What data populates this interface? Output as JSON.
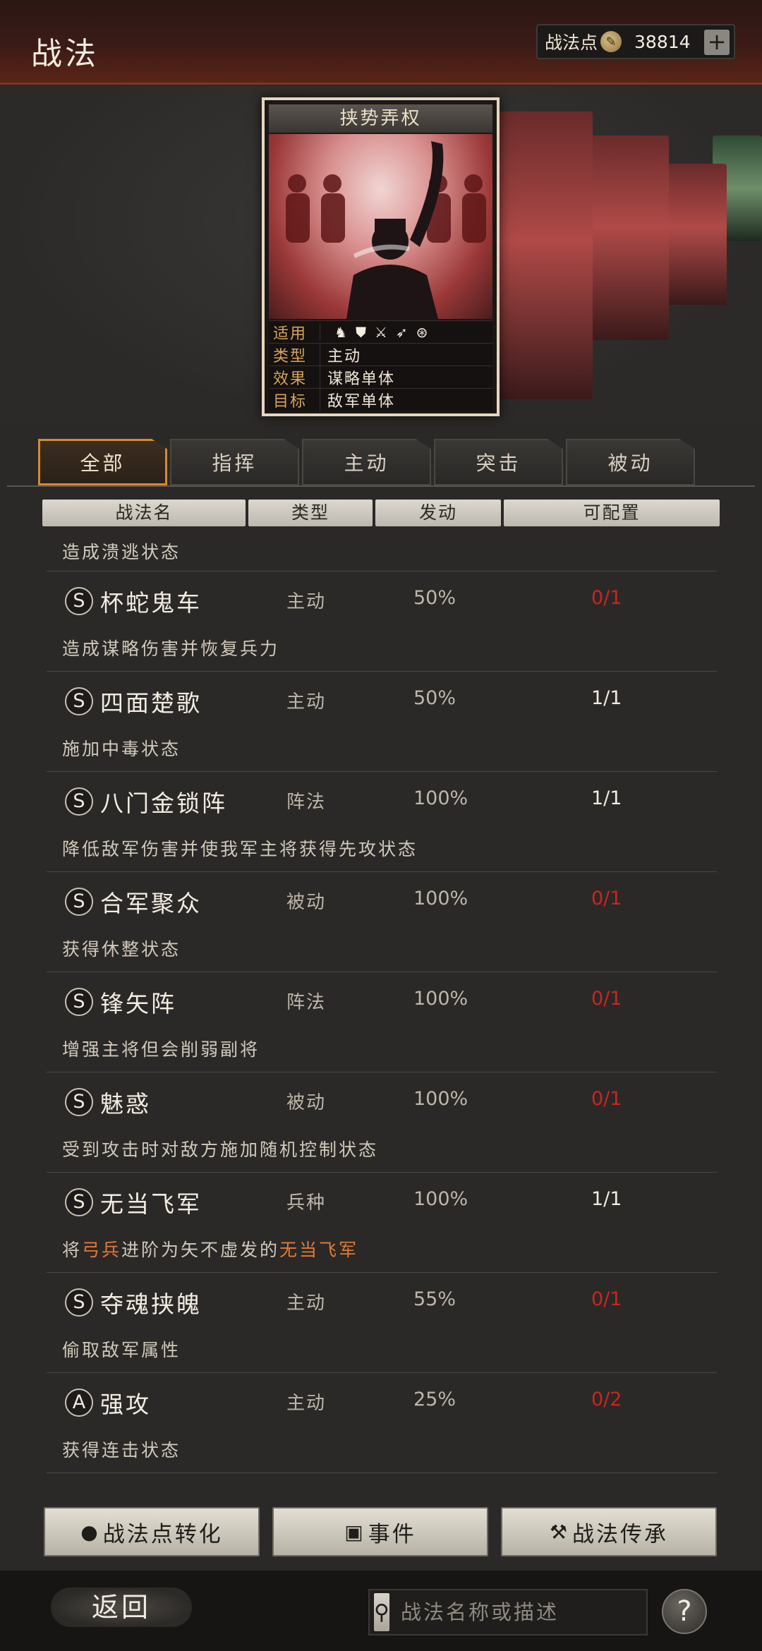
{
  "header": {
    "title": "战法",
    "points_label": "战法点",
    "points_value": "38814",
    "plus_label": "+"
  },
  "card": {
    "name": "挟势弄权",
    "rows": [
      {
        "key": "适用",
        "value": ""
      },
      {
        "key": "类型",
        "value": "主动"
      },
      {
        "key": "效果",
        "value": "谋略单体"
      },
      {
        "key": "目标",
        "value": "敌军单体"
      }
    ],
    "unit_icons": [
      "♞",
      "⛊",
      "⚔",
      "➶",
      "⊛"
    ]
  },
  "tabs": [
    "全部",
    "指挥",
    "主动",
    "突击",
    "被动"
  ],
  "columns": [
    "战法名",
    "类型",
    "发动",
    "可配置"
  ],
  "list": {
    "top_desc": "造成溃逃状态",
    "rows": [
      {
        "grade": "S",
        "name": "杯蛇鬼车",
        "type": "主动",
        "rate": "50%",
        "config": "0/1",
        "config_red": true,
        "desc": "造成谋略伤害并恢复兵力"
      },
      {
        "grade": "S",
        "name": "四面楚歌",
        "type": "主动",
        "rate": "50%",
        "config": "1/1",
        "config_red": false,
        "desc": "施加中毒状态"
      },
      {
        "grade": "S",
        "name": "八门金锁阵",
        "type": "阵法",
        "rate": "100%",
        "config": "1/1",
        "config_red": false,
        "desc": "降低敌军伤害并使我军主将获得先攻状态"
      },
      {
        "grade": "S",
        "name": "合军聚众",
        "type": "被动",
        "rate": "100%",
        "config": "0/1",
        "config_red": true,
        "desc": "获得休整状态"
      },
      {
        "grade": "S",
        "name": "锋矢阵",
        "type": "阵法",
        "rate": "100%",
        "config": "0/1",
        "config_red": true,
        "desc": "增强主将但会削弱副将"
      },
      {
        "grade": "S",
        "name": "魅惑",
        "type": "被动",
        "rate": "100%",
        "config": "0/1",
        "config_red": true,
        "desc": "受到攻击时对敌方施加随机控制状态"
      },
      {
        "grade": "S",
        "name": "无当飞军",
        "type": "兵种",
        "rate": "100%",
        "config": "1/1",
        "config_red": false,
        "desc_parts": [
          "将",
          "弓兵",
          "进阶为矢不虚发的",
          "无当飞军"
        ]
      },
      {
        "grade": "S",
        "name": "夺魂挟魄",
        "type": "主动",
        "rate": "55%",
        "config": "0/1",
        "config_red": true,
        "desc": "偷取敌军属性"
      },
      {
        "grade": "A",
        "name": "强攻",
        "type": "主动",
        "rate": "25%",
        "config": "0/2",
        "config_red": true,
        "desc": "获得连击状态"
      }
    ]
  },
  "buttons": {
    "convert": "战法点转化",
    "event": "事件",
    "inherit": "战法传承"
  },
  "footer": {
    "back": "返回",
    "search_placeholder": "战法名称或描述",
    "help": "?"
  },
  "colors": {
    "accent": "#d58a35",
    "config_red": "#c8261e",
    "highlight": "#e07a3a"
  }
}
